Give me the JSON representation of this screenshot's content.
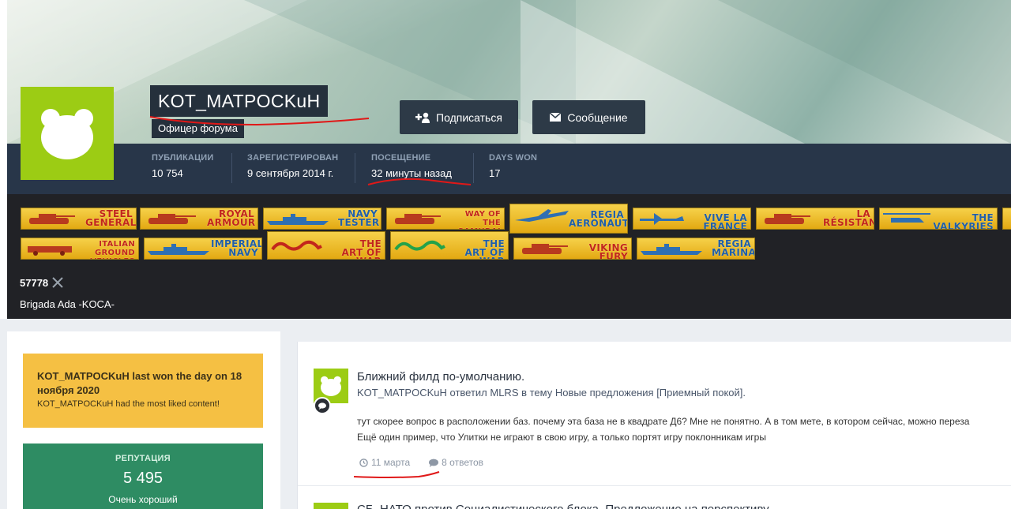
{
  "profile": {
    "username": "KOT_MATPOCKuH",
    "rank": "Офицер форума",
    "actions": {
      "follow_label": "Подписаться",
      "message_label": "Сообщение"
    },
    "stats": [
      {
        "label": "ПУБЛИКАЦИИ",
        "value": "10 754"
      },
      {
        "label": "ЗАРЕГИСТРИРОВАН",
        "value": "9 сентября 2014 г."
      },
      {
        "label": "ПОСЕЩЕНИЕ",
        "value": "32 минуты назад"
      },
      {
        "label": "DAYS WON",
        "value": "17"
      }
    ]
  },
  "awards": [
    {
      "text": "STEEL GENERALS",
      "icon": "tank-icon"
    },
    {
      "text": "ROYAL ARMOUR",
      "icon": "tank-icon"
    },
    {
      "text": "NAVY TESTER",
      "icon": "battleship-icon"
    },
    {
      "text": "WAY OF THE SAMURAI",
      "icon": "tank-icon"
    },
    {
      "text": "REGIA AERONAUTICA",
      "icon": "jet-icon"
    },
    {
      "text": "VIVE LA FRANCE",
      "icon": "fighter-plane-icon"
    },
    {
      "text": "LA RÉSISTANCE",
      "icon": "tank-icon"
    },
    {
      "text": "THE VALKYRIES",
      "icon": "helicopter-icon"
    },
    {
      "text": "ITALIAN GROUND VEHICLES",
      "icon": "armored-car-icon"
    },
    {
      "text": "IMPERIAL NAVY",
      "icon": "battleship-icon"
    },
    {
      "text": "THE ART OF WAR",
      "icon": "red-dragon-icon"
    },
    {
      "text": "THE ART OF WAR",
      "icon": "green-dragon-icon"
    },
    {
      "text": "VIKING FURY",
      "icon": "tank-icon"
    },
    {
      "text": "REGIA MARINA",
      "icon": "battleship-icon"
    }
  ],
  "clan": {
    "id": "57778",
    "name": "Brigada Ada -KOCA-",
    "icon": "crossed-swords-icon"
  },
  "day_won": {
    "title": "KOT_MATPOCKuH last won the day on 18 ноября 2020",
    "subtitle": "KOT_MATPOCKuH had the most liked content!"
  },
  "reputation": {
    "label": "РЕПУТАЦИЯ",
    "value": "5 495",
    "description": "Очень хороший"
  },
  "feed": {
    "post1": {
      "title": "Ближний филд по-умолчанию.",
      "meta": "KOT_MATPOCKuH ответил MLRS в тему Новые предложения [Приемный покой].",
      "body_line1": "тут скорее вопрос в расположении баз. почему эта база не в квадрате Д6? Мне не понятно. А в том мете, в котором сейчас, можно переза",
      "body_line2": "Ещё один пример, что Улитки не играют в свою игру, а только портят игру поклонникам игры",
      "date": "11 марта",
      "replies": "8 ответов"
    },
    "post2": {
      "title": "СБ. НАТО против Социалистического блока. Предложение на перспективу"
    }
  }
}
